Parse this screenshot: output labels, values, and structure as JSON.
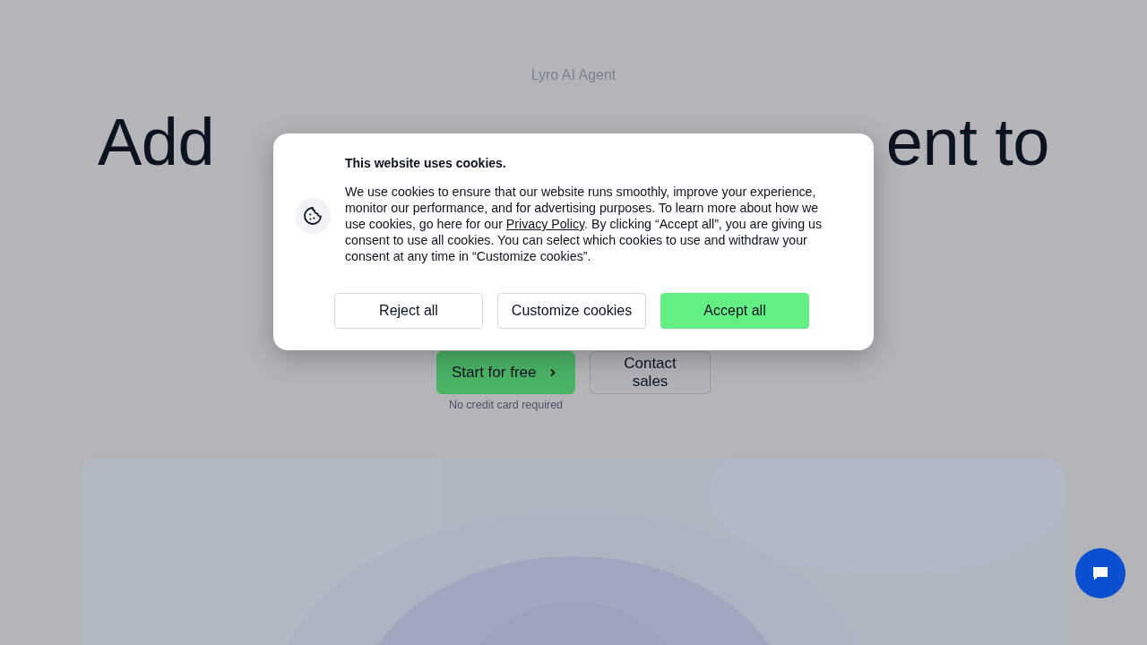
{
  "hero": {
    "eyebrow": "Lyro AI Agent",
    "headline_start": "Add",
    "headline_end": "ent to",
    "actions": [
      {
        "label": "Start for free",
        "kind": "primary"
      },
      {
        "label": "Contact sales",
        "kind": "secondary"
      }
    ],
    "note": "No credit card required"
  },
  "cookie_dialog": {
    "title": "This website uses cookies.",
    "body_before": "We use cookies to ensure that our website runs smoothly, improve your experience, monitor our performance, and for advertising purposes. To learn more about how we use cookies, go here for our ",
    "link": "Privacy Policy",
    "body_after": ". By clicking “Accept all”, you are giving us consent to use all cookies. You can select which cookies to use and withdraw your consent at any time in “Customize cookies”.",
    "buttons": [
      {
        "label": "Reject all",
        "kind": "outline"
      },
      {
        "label": "Customize cookies",
        "kind": "outline"
      },
      {
        "label": "Accept all",
        "kind": "primary"
      }
    ]
  },
  "chat_launcher": {
    "kind": "chat"
  }
}
